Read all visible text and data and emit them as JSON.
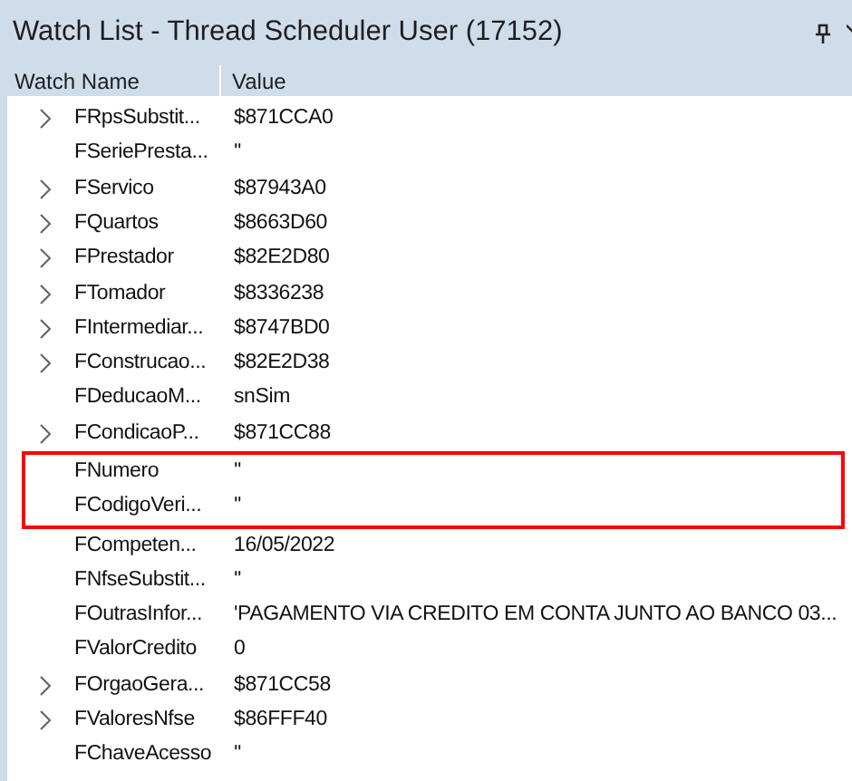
{
  "window": {
    "title": "Watch List - Thread Scheduler User (17152)"
  },
  "columns": [
    "Watch Name",
    "Value"
  ],
  "rows": [
    {
      "name": "FRpsSubstit...",
      "value": "$871CCA0",
      "expandable": true,
      "highlighted": false
    },
    {
      "name": "FSeriePresta...",
      "value": "''",
      "expandable": false,
      "highlighted": false
    },
    {
      "name": "FServico",
      "value": "$87943A0",
      "expandable": true,
      "highlighted": false
    },
    {
      "name": "FQuartos",
      "value": "$8663D60",
      "expandable": true,
      "highlighted": false
    },
    {
      "name": "FPrestador",
      "value": "$82E2D80",
      "expandable": true,
      "highlighted": false
    },
    {
      "name": "FTomador",
      "value": "$8336238",
      "expandable": true,
      "highlighted": false
    },
    {
      "name": "FIntermediar...",
      "value": "$8747BD0",
      "expandable": true,
      "highlighted": false
    },
    {
      "name": "FConstrucao...",
      "value": "$82E2D38",
      "expandable": true,
      "highlighted": false
    },
    {
      "name": "FDeducaoM...",
      "value": "snSim",
      "expandable": false,
      "highlighted": false
    },
    {
      "name": "FCondicaoP...",
      "value": "$871CC88",
      "expandable": true,
      "highlighted": false
    },
    {
      "name": "FNumero",
      "value": "''",
      "expandable": false,
      "highlighted": true
    },
    {
      "name": "FCodigoVeri...",
      "value": "''",
      "expandable": false,
      "highlighted": true
    },
    {
      "name": "FCompeten...",
      "value": "16/05/2022",
      "expandable": false,
      "highlighted": false
    },
    {
      "name": "FNfseSubstit...",
      "value": "''",
      "expandable": false,
      "highlighted": false
    },
    {
      "name": "FOutrasInfor...",
      "value": "'PAGAMENTO VIA CREDITO EM CONTA JUNTO AO BANCO 03...",
      "expandable": false,
      "highlighted": false
    },
    {
      "name": "FValorCredito",
      "value": "0",
      "expandable": false,
      "highlighted": false
    },
    {
      "name": "FOrgaoGera...",
      "value": "$871CC58",
      "expandable": true,
      "highlighted": false
    },
    {
      "name": "FValoresNfse",
      "value": "$86FFF40",
      "expandable": true,
      "highlighted": false
    },
    {
      "name": "FChaveAcesso",
      "value": "''",
      "expandable": false,
      "highlighted": false
    }
  ]
}
